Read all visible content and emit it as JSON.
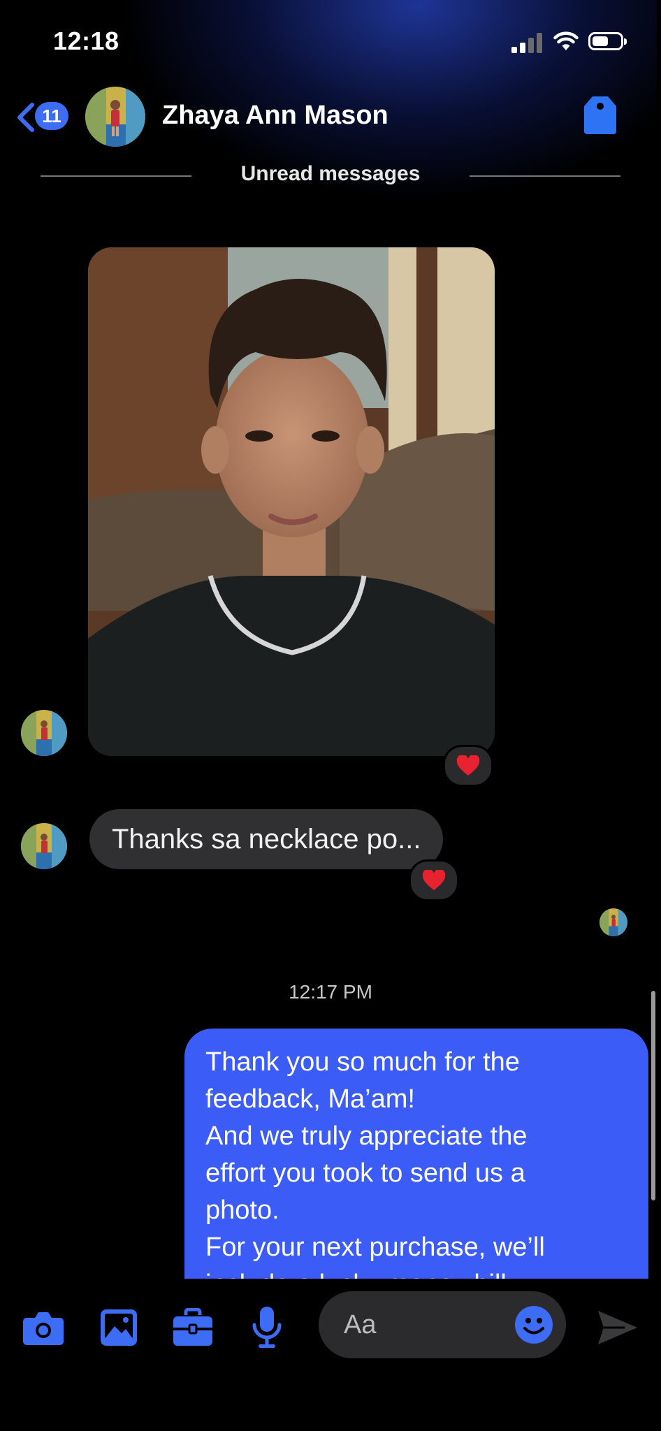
{
  "status_bar": {
    "time": "12:18"
  },
  "header": {
    "back_badge": "11",
    "contact_name": "Zhaya Ann Mason"
  },
  "divider_label": "Unread messages",
  "messages": {
    "incoming_text": "Thanks sa necklace po...",
    "incoming_reaction": "❤️",
    "photo_reaction": "❤️",
    "timestamp": "12:17 PM",
    "outgoing_text": "Thank you so much for the\nfeedback, Ma’am!\nAnd we truly appreciate the\neffort you took to send us a\nphoto.\nFor your next purchase, we’ll\ninclude a lucky money bill"
  },
  "composer": {
    "placeholder": "Aa"
  },
  "colors": {
    "accent": "#3b5cf7",
    "bubble_in": "#303033",
    "background": "#000000"
  },
  "icons": [
    "back-chevron-icon",
    "tag-icon",
    "camera-icon",
    "gallery-icon",
    "briefcase-icon",
    "microphone-icon",
    "emoji-icon",
    "send-icon",
    "heart-icon"
  ]
}
